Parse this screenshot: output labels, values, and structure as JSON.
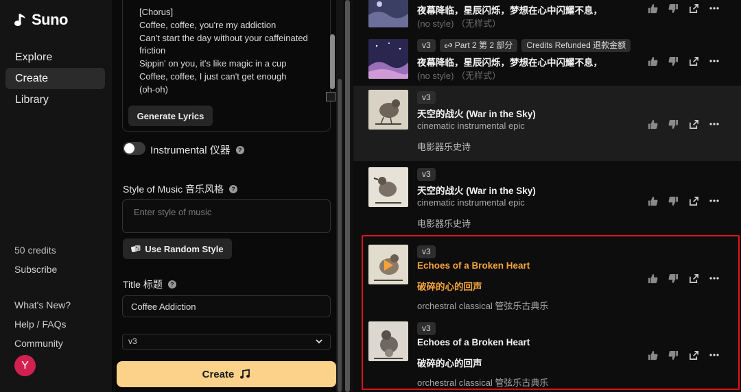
{
  "app": {
    "name": "Suno"
  },
  "sidebar": {
    "nav": [
      {
        "label": "Explore",
        "active": false
      },
      {
        "label": "Create",
        "active": true
      },
      {
        "label": "Library",
        "active": false
      }
    ],
    "credits": "50 credits",
    "subscribe": "Subscribe",
    "links": [
      "What's New?",
      "Help / FAQs",
      "Community"
    ],
    "avatar_letter": "Y",
    "avatar_color": "#d3214f"
  },
  "form": {
    "lyrics": "[Chorus]\nCoffee, coffee, you're my addiction\nCan't start the day without your caffeinated friction\nSippin' on you, it's like magic in a cup\nCoffee, coffee, I just can't get enough\n(oh-oh)",
    "generate_lyrics": "Generate Lyrics",
    "instrumental_label": "Instrumental 仪器",
    "instrumental_on": false,
    "style_label": "Style of Music 音乐风格",
    "style_placeholder": "Enter style of music",
    "random_style": "Use Random Style",
    "title_label": "Title 标题",
    "title_value": "Coffee Addiction",
    "model": "v3",
    "create_label": "Create",
    "create_color": "#fcd28b"
  },
  "songs": [
    {
      "tags": [],
      "title": "夜幕降临，星辰闪烁，梦想在心中闪耀不息，",
      "sub": "(no style) （无样式）",
      "sub2": "",
      "orange": false
    },
    {
      "tags": [
        "v3",
        "Part 2 第 2 部分",
        "Credits Refunded 退款金额"
      ],
      "title": "夜幕降临，星辰闪烁，梦想在心中闪耀不息，",
      "sub": "(no style) （无样式）",
      "sub2": "",
      "orange": false
    },
    {
      "tags": [
        "v3"
      ],
      "title": "天空的战火 (War in the Sky)",
      "sub": "cinematic instrumental epic",
      "sub2": "电影器乐史诗",
      "orange": false
    },
    {
      "tags": [
        "v3"
      ],
      "title": "天空的战火 (War in the Sky)",
      "sub": "cinematic instrumental epic",
      "sub2": "电影器乐史诗",
      "orange": false
    },
    {
      "tags": [
        "v3"
      ],
      "title": "Echoes of a Broken Heart",
      "title2": "破碎的心的回声",
      "sub": "orchestral classical 管弦乐古典乐",
      "orange": true
    },
    {
      "tags": [
        "v3"
      ],
      "title": "Echoes of a Broken Heart",
      "title2": "破碎的心的回声",
      "sub": "orchestral classical 管弦乐古典乐",
      "orange": false
    }
  ],
  "colors": {
    "accent_orange": "#f6a33a",
    "highlight_red": "#e0141a"
  }
}
